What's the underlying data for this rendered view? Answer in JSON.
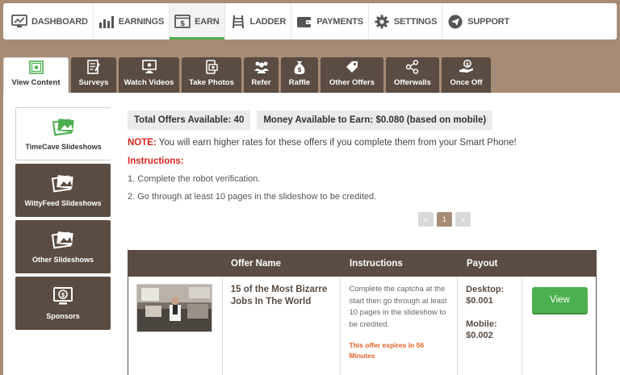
{
  "nav": {
    "items": [
      {
        "label": "DASHBOARD",
        "icon": "dashboard-icon"
      },
      {
        "label": "EARNINGS",
        "icon": "bar-chart-icon"
      },
      {
        "label": "EARN",
        "icon": "dollar-window-icon"
      },
      {
        "label": "LADDER",
        "icon": "ladder-icon"
      },
      {
        "label": "PAYMENTS",
        "icon": "wallet-icon"
      },
      {
        "label": "SETTINGS",
        "icon": "gear-icon"
      },
      {
        "label": "SUPPORT",
        "icon": "paper-plane-icon"
      }
    ],
    "active": "EARN"
  },
  "tabs": [
    {
      "label": "View Content",
      "icon": "view-content-icon"
    },
    {
      "label": "Surveys",
      "icon": "survey-icon"
    },
    {
      "label": "Watch Videos",
      "icon": "video-icon"
    },
    {
      "label": "Take Photos",
      "icon": "photo-icon"
    },
    {
      "label": "Refer",
      "icon": "people-icon"
    },
    {
      "label": "Raffle",
      "icon": "money-bag-icon"
    },
    {
      "label": "Other Offers",
      "icon": "tag-icon"
    },
    {
      "label": "Offerwalls",
      "icon": "share-icon"
    },
    {
      "label": "Once Off",
      "icon": "hand-coin-icon"
    }
  ],
  "side": [
    {
      "label": "TimeCave Slideshows",
      "icon": "slideshow-icon"
    },
    {
      "label": "WittyFeed Slideshows",
      "icon": "slideshow-icon"
    },
    {
      "label": "Other Slideshows",
      "icon": "slideshow-icon"
    },
    {
      "label": "Sponsors",
      "icon": "sponsor-icon"
    }
  ],
  "main": {
    "total_offers": "Total Offers Available: 40",
    "money_available": "Money Available to Earn: $0.080 (based on mobile)",
    "note_label": "NOTE:",
    "note_text": " You will earn higher rates for these offers if you complete them from your Smart Phone!",
    "instructions_title": "Instructions:",
    "steps": [
      "1. Complete the robot verification.",
      "2. Go through at least 10 pages in the slideshow to be credited."
    ],
    "pager": {
      "prev": "«",
      "current": "1",
      "next": "»"
    }
  },
  "table": {
    "headers": [
      "",
      "Offer Name",
      "Instructions",
      "Payout",
      ""
    ],
    "rows": [
      {
        "offer_name": "15 of the Most Bizarre Jobs In The World",
        "instructions": "Complete the captcha at the start then go through at least 10 pages in the slideshow to be credited.",
        "expires": "This offer expires in 56 Minutes",
        "desktop_label": "Desktop:",
        "desktop_value": "$0.001",
        "mobile_label": "Mobile:",
        "mobile_value": "$0.002",
        "button": "View"
      }
    ]
  },
  "colors": {
    "brown": "#5a4c42",
    "accent_green": "#4caf50",
    "note_red": "#d9241c",
    "expire_orange": "#e06020",
    "background": "#a88b74"
  }
}
